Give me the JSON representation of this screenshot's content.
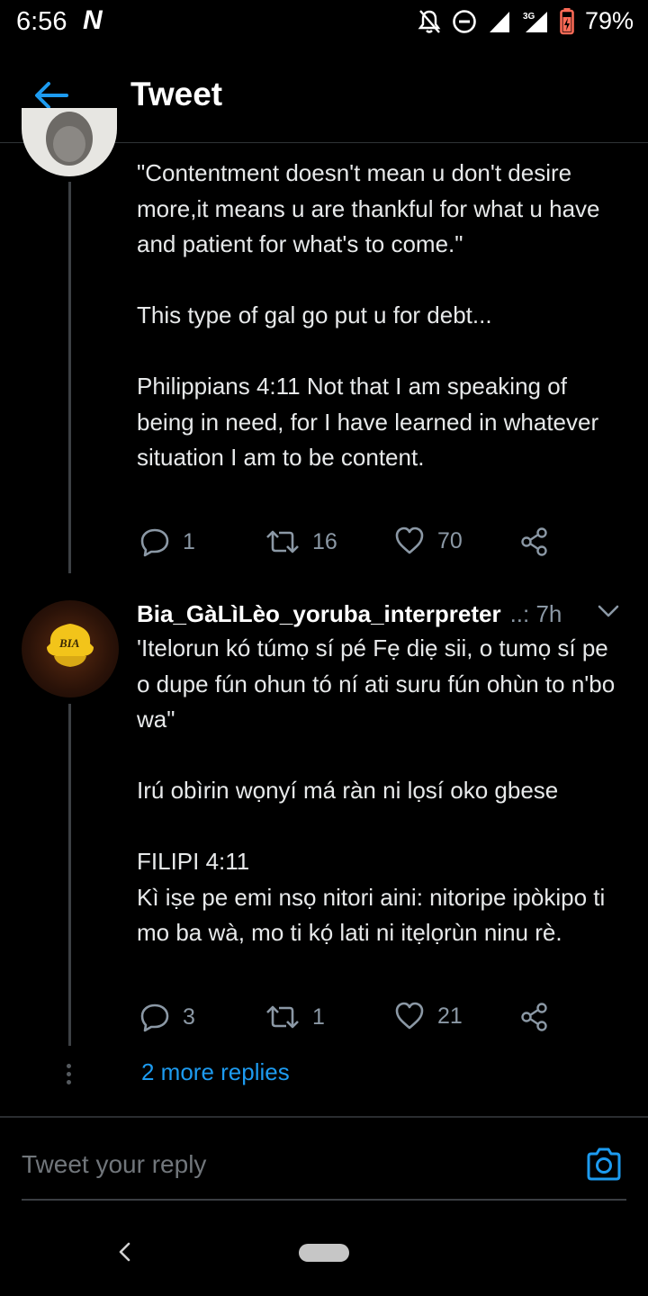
{
  "status_bar": {
    "time": "6:56",
    "carrier_logo": "N",
    "network": "3G",
    "battery": "79%",
    "icons": [
      "notifications-off-icon",
      "do-not-disturb-icon",
      "signal-icon",
      "signal-3g-icon",
      "battery-charging-icon"
    ]
  },
  "header": {
    "title": "Tweet",
    "back_icon": "arrow-left-icon"
  },
  "tweets": [
    {
      "text": [
        "\"Contentment doesn't mean u don't desire more,it means u are thankful for what u have and patient for what's to come.\"",
        "This type of gal go put u for debt...",
        "Philippians 4:11 Not that I am speaking of being in need, for I have learned in whatever situation I am to be content."
      ],
      "replies": "1",
      "retweets": "16",
      "likes": "70"
    },
    {
      "author": "Bia_GàLìLèo_yoruba_interpreter",
      "meta": "..: 7h",
      "avatar_text": "BIA",
      "text": [
        "'Itelorun kó túmọ sí pé Fẹ diẹ sii, o tumọ sí pe o dupe fún ohun tó ní ati suru fún ohùn to n'bo wa\"",
        "Irú obìrin wọnyí má ràn ni lọsí oko gbese",
        "FILIPI 4:11\nKì iṣe pe emi nsọ nitori aini: nitoripe ipòkipo ti mo ba wà, mo ti kọ́ lati ni itẹlọrùn ninu rè."
      ],
      "replies": "3",
      "retweets": "1",
      "likes": "21"
    }
  ],
  "more_replies": "2 more replies",
  "reply_box": {
    "placeholder": "Tweet your reply"
  },
  "colors": {
    "accent": "#1d9bf0",
    "background": "#000000",
    "muted": "#8b98a5"
  }
}
